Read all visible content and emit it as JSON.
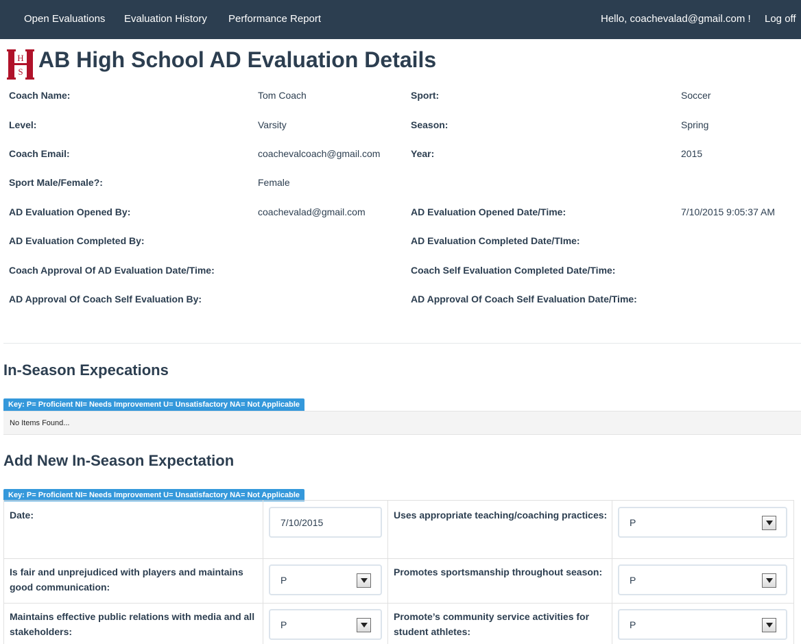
{
  "nav": {
    "links": [
      "Open Evaluations",
      "Evaluation History",
      "Performance Report"
    ],
    "greeting": "Hello, coachevalad@gmail.com !",
    "logoff": "Log off"
  },
  "logo": {
    "letters": [
      "H",
      "S"
    ],
    "color": "#b0122a"
  },
  "page": {
    "title": "AB High School AD Evaluation Details"
  },
  "details": [
    {
      "label": "Coach Name:",
      "value": "Tom Coach"
    },
    {
      "label": "Sport:",
      "value": "Soccer"
    },
    {
      "label": "Level:",
      "value": "Varsity"
    },
    {
      "label": "Season:",
      "value": "Spring"
    },
    {
      "label": "Coach Email:",
      "value": "coachevalcoach@gmail.com"
    },
    {
      "label": "Year:",
      "value": "2015"
    },
    {
      "label": "Sport Male/Female?:",
      "value": "Female"
    },
    {
      "label": "",
      "value": ""
    },
    {
      "label": "AD Evaluation Opened By:",
      "value": "coachevalad@gmail.com"
    },
    {
      "label": "AD Evaluation Opened Date/Time:",
      "value": "7/10/2015 9:05:37 AM"
    },
    {
      "label": "AD Evaluation Completed By:",
      "value": ""
    },
    {
      "label": "AD Evaluation Completed Date/TIme:",
      "value": ""
    },
    {
      "label": "Coach Approval Of AD Evaluation Date/Time:",
      "value": ""
    },
    {
      "label": "Coach Self Evaluation Completed Date/Time:",
      "value": ""
    },
    {
      "label": "AD Approval Of Coach Self Evaluation By:",
      "value": ""
    },
    {
      "label": "AD Approval Of Coach Self Evaluation Date/Time:",
      "value": ""
    }
  ],
  "in_season": {
    "title": "In-Season Expecations",
    "key": "Key: P= Proficient NI= Needs Improvement U= Unsatisfactory NA= Not Applicable",
    "empty_text": "No Items Found..."
  },
  "add_new": {
    "title": "Add New In-Season Expectation",
    "key": "Key: P= Proficient NI= Needs Improvement U= Unsatisfactory NA= Not Applicable",
    "fields": [
      {
        "label": "Date:",
        "value": "7/10/2015",
        "kind": "text"
      },
      {
        "label": "Uses appropriate teaching/coaching practices:",
        "value": "P",
        "kind": "select"
      },
      {
        "label": "Is fair and unprejudiced with players and maintains good communication:",
        "value": "P",
        "kind": "select"
      },
      {
        "label": "Promotes sportsmanship throughout season:",
        "value": "P",
        "kind": "select"
      },
      {
        "label": "Maintains effective public relations with media and all stakeholders:",
        "value": "P",
        "kind": "select"
      },
      {
        "label": "Promote’s community service activities for student athletes:",
        "value": "P",
        "kind": "select"
      }
    ]
  },
  "colors": {
    "navbar": "#2c3e50",
    "text": "#2c3e50",
    "key_badge": "#3498db",
    "logo": "#b0122a"
  }
}
